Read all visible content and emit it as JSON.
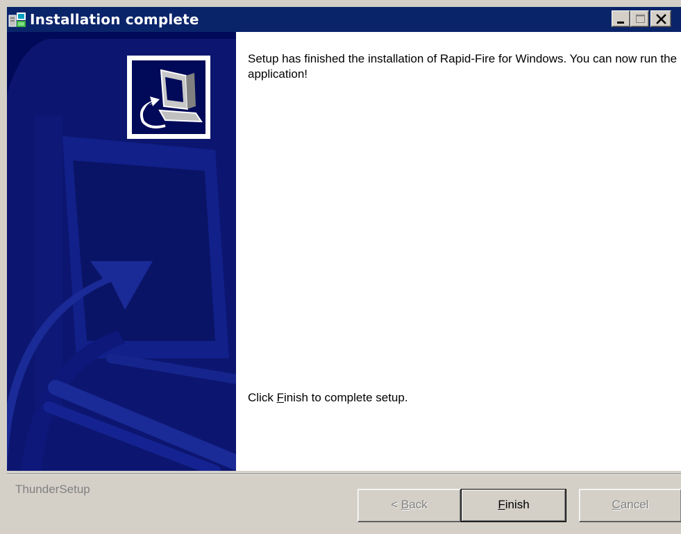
{
  "window": {
    "title": "Installation complete",
    "controls": {
      "minimize": "minimize",
      "maximize": "maximize",
      "close": "close"
    }
  },
  "content": {
    "message": "Setup has finished the installation of Rapid-Fire for Windows. You can now run the application!",
    "finish_hint_before": "Click ",
    "finish_hint_accel": "F",
    "finish_hint_after": "inish to complete setup."
  },
  "footer": {
    "brand": "ThunderSetup"
  },
  "buttons": {
    "back_prefix": "< ",
    "back_accel": "B",
    "back_rest": "ack",
    "finish_accel": "F",
    "finish_rest": "inish",
    "cancel_accel": "C",
    "cancel_rest": "ancel"
  },
  "icons": {
    "app": "setup-icon",
    "wizard": "computer-install-icon"
  },
  "colors": {
    "titlebar": "#0a246a",
    "side_panel": "#000a58",
    "face": "#d4d0c8",
    "disabled_text": "#808080"
  }
}
